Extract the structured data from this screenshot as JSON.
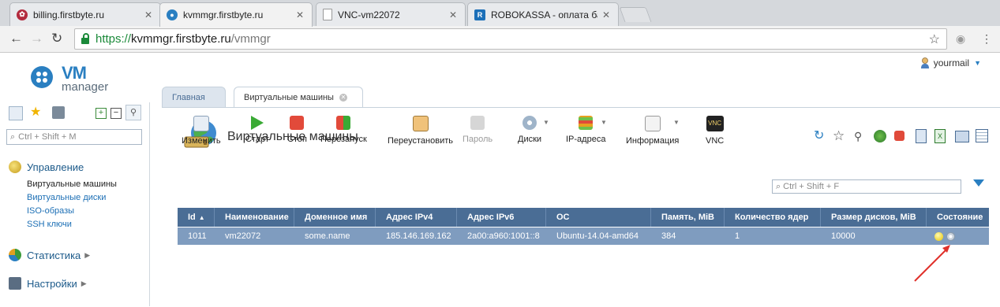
{
  "browser": {
    "tabs": [
      {
        "title": "billing.firstbyte.ru",
        "icon": "billing-favicon-icon"
      },
      {
        "title": "kvmmgr.firstbyte.ru",
        "icon": "vmmanager-favicon-icon"
      },
      {
        "title": "VNC-vm22072",
        "icon": "page-icon"
      },
      {
        "title": "ROBOKASSA - оплата бан",
        "icon": "robokassa-favicon-icon"
      }
    ],
    "url": {
      "scheme": "https://",
      "host": "kvmmgr.firstbyte.ru",
      "path": "/vmmgr"
    }
  },
  "logo": {
    "vm": "VM",
    "manager": "manager"
  },
  "user": {
    "name": "yourmail"
  },
  "sidebar": {
    "search_placeholder": "Ctrl + Shift + M",
    "sections": [
      {
        "label": "Управление",
        "items": [
          "Виртуальные машины",
          "Виртуальные диски",
          "ISO-образы",
          "SSH ключи"
        ]
      },
      {
        "label": "Статистика"
      },
      {
        "label": "Настройки"
      }
    ]
  },
  "tabs": [
    {
      "label": "Главная"
    },
    {
      "label": "Виртуальные машины"
    }
  ],
  "page": {
    "title": "Виртуальные машины"
  },
  "toolbar": {
    "buttons": [
      "Изменить",
      "Старт",
      "Стоп",
      "Перезапуск",
      "Переустановить",
      "Пароль",
      "Диски",
      "IP-адреса",
      "Информация",
      "VNC"
    ]
  },
  "filter": {
    "placeholder": "Ctrl + Shift + F"
  },
  "table": {
    "headers": [
      "Id",
      "Наименование",
      "Доменное имя",
      "Адрес IPv4",
      "Адрес IPv6",
      "ОС",
      "Память, MiB",
      "Количество ядер",
      "Размер дисков, MiB",
      "Состояние"
    ],
    "rows": [
      [
        "1011",
        "vm22072",
        "some.name",
        "185.146.169.162",
        "2a00:a960:1001::8",
        "Ubuntu-14.04-amd64",
        "384",
        "1",
        "10000"
      ]
    ]
  },
  "colors": {
    "header": "#4a6d95",
    "selected_row": "#7f9cbf",
    "link": "#1c6fb5",
    "annotation_arrow": "#e0312b"
  }
}
